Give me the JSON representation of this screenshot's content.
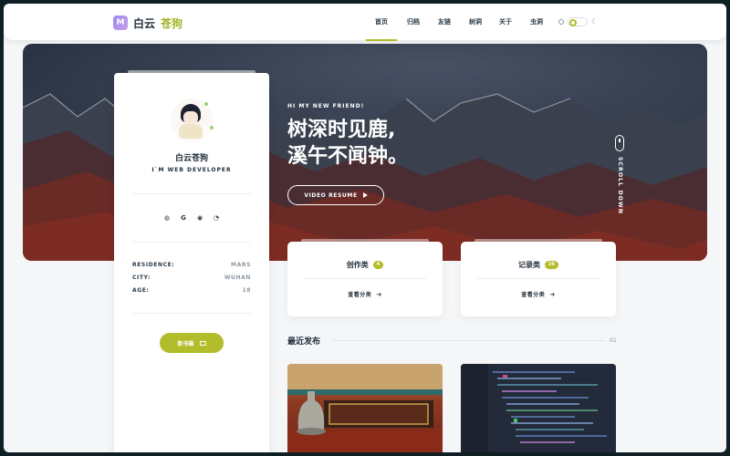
{
  "header": {
    "logo_mark": "M",
    "logo_name_a": "白云",
    "logo_name_b": "苍狗",
    "nav": [
      "首页",
      "归档",
      "友链",
      "树洞",
      "关于",
      "虫洞"
    ],
    "active_nav": "首页",
    "accent_color": "#b3bd2b"
  },
  "hero": {
    "subtitle": "HI MY NEW FRIEND!",
    "title_line1": "树深时见鹿,",
    "title_line2": "溪午不闻钟。",
    "resume_button": "VIDEO RESUME",
    "scroll_text": "SCROLL DOWN"
  },
  "profile": {
    "name": "白云苍狗",
    "role": "I`M WEB DEVELOPER",
    "socials": [
      "github-icon",
      "gitee-icon",
      "weibo-icon",
      "rss-icon"
    ],
    "info": [
      {
        "key": "RESIDENCE:",
        "value": "MARS"
      },
      {
        "key": "CITY:",
        "value": "WUHAN"
      },
      {
        "key": "AGE:",
        "value": "18"
      }
    ],
    "subscribe_button": "新书箱"
  },
  "categories": [
    {
      "title": "创作类",
      "count": "4",
      "link": "查看分类"
    },
    {
      "title": "记录类",
      "count": "20",
      "link": "查看分类"
    }
  ],
  "recent": {
    "title": "最近发布",
    "count": "01"
  }
}
